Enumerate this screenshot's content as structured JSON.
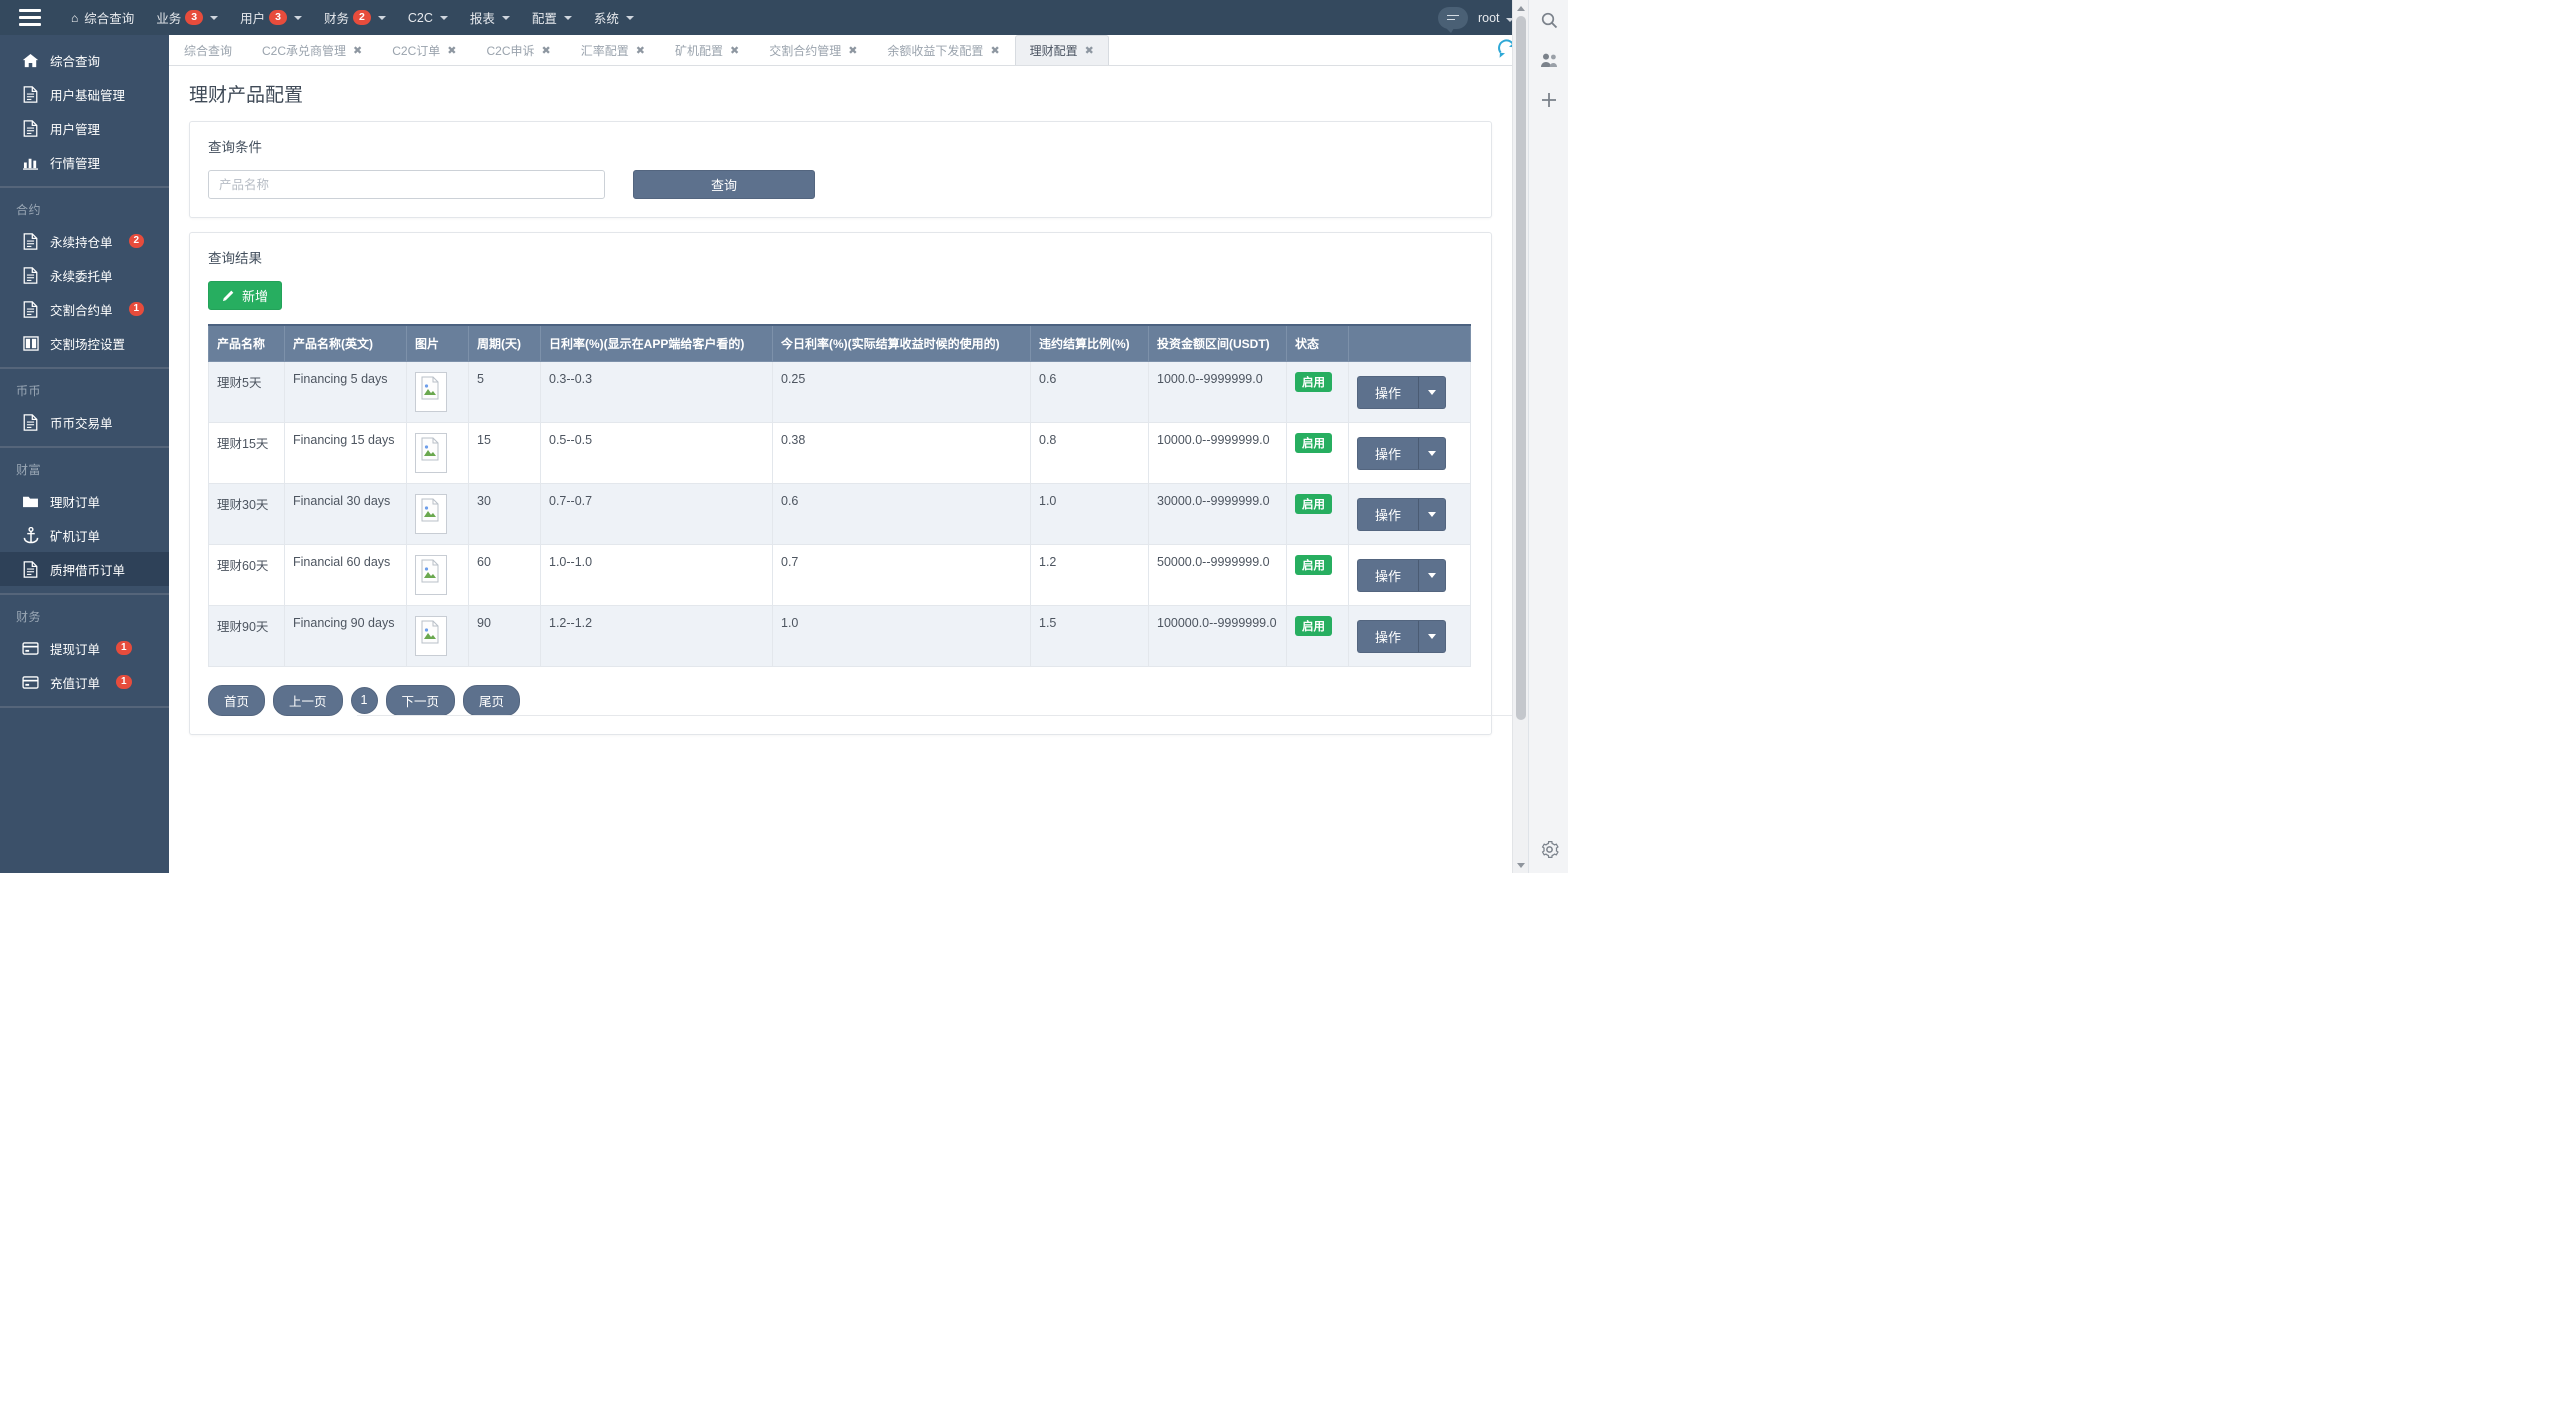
{
  "navbar": {
    "menu_icon": "hamburger-icon",
    "home_icon": "home-icon",
    "items": [
      {
        "label": "综合查询",
        "badge": null,
        "caret": false,
        "home": true
      },
      {
        "label": "业务",
        "badge": "3",
        "caret": true,
        "home": false
      },
      {
        "label": "用户",
        "badge": "3",
        "caret": true,
        "home": false
      },
      {
        "label": "财务",
        "badge": "2",
        "caret": true,
        "home": false
      },
      {
        "label": "C2C",
        "badge": null,
        "caret": true,
        "home": false
      },
      {
        "label": "报表",
        "badge": null,
        "caret": true,
        "home": false
      },
      {
        "label": "配置",
        "badge": null,
        "caret": true,
        "home": false
      },
      {
        "label": "系统",
        "badge": null,
        "caret": true,
        "home": false
      }
    ],
    "chat_icon": "chat-icon",
    "user": "root"
  },
  "sidebar": {
    "groups": [
      {
        "title": null,
        "items": [
          {
            "label": "综合查询",
            "icon": "home-icon",
            "badge": null,
            "active": false
          },
          {
            "label": "用户基础管理",
            "icon": "document-icon",
            "badge": null,
            "active": false
          },
          {
            "label": "用户管理",
            "icon": "document-icon",
            "badge": null,
            "active": false
          },
          {
            "label": "行情管理",
            "icon": "bar-chart-icon",
            "badge": null,
            "active": false
          }
        ]
      },
      {
        "title": "合约",
        "items": [
          {
            "label": "永续持仓单",
            "icon": "document-icon",
            "badge": "2",
            "active": false
          },
          {
            "label": "永续委托单",
            "icon": "document-icon",
            "badge": null,
            "active": false
          },
          {
            "label": "交割合约单",
            "icon": "document-icon",
            "badge": "1",
            "active": false
          },
          {
            "label": "交割场控设置",
            "icon": "columns-icon",
            "badge": null,
            "active": false
          }
        ]
      },
      {
        "title": "币币",
        "items": [
          {
            "label": "币币交易单",
            "icon": "document-icon",
            "badge": null,
            "active": false
          }
        ]
      },
      {
        "title": "财富",
        "items": [
          {
            "label": "理财订单",
            "icon": "folder-icon",
            "badge": null,
            "active": false
          },
          {
            "label": "矿机订单",
            "icon": "anchor-icon",
            "badge": null,
            "active": false
          },
          {
            "label": "质押借币订单",
            "icon": "document-icon",
            "badge": null,
            "active": true
          }
        ]
      },
      {
        "title": "财务",
        "items": [
          {
            "label": "提现订单",
            "icon": "credit-card-icon",
            "badge": "1",
            "active": false
          },
          {
            "label": "充值订单",
            "icon": "credit-card-icon",
            "badge": "1",
            "active": false
          }
        ]
      }
    ]
  },
  "tabs": {
    "items": [
      {
        "label": "综合查询",
        "closable": false,
        "active": false
      },
      {
        "label": "C2C承兑商管理",
        "closable": true,
        "active": false
      },
      {
        "label": "C2C订单",
        "closable": true,
        "active": false
      },
      {
        "label": "C2C申诉",
        "closable": true,
        "active": false
      },
      {
        "label": "汇率配置",
        "closable": true,
        "active": false
      },
      {
        "label": "矿机配置",
        "closable": true,
        "active": false
      },
      {
        "label": "交割合约管理",
        "closable": true,
        "active": false
      },
      {
        "label": "余额收益下发配置",
        "closable": true,
        "active": false
      },
      {
        "label": "理财配置",
        "closable": true,
        "active": true
      }
    ],
    "close_glyph": "✖",
    "refresh_icon": "refresh-icon"
  },
  "page": {
    "title": "理财产品配置"
  },
  "query_panel": {
    "heading": "查询条件",
    "product_name_placeholder": "产品名称",
    "product_name_value": "",
    "search_button": "查询"
  },
  "result_panel": {
    "heading": "查询结果",
    "add_button": "新增",
    "add_icon": "pencil-icon",
    "columns": [
      "产品名称",
      "产品名称(英文)",
      "图片",
      "周期(天)",
      "日利率(%)(显示在APP端给客户看的)",
      "今日利率(%)(实际结算收益时候的使用的)",
      "违约结算比例(%)",
      "投资金额区间(USDT)",
      "状态",
      ""
    ],
    "rows": [
      {
        "name": "理财5天",
        "name_en": "Financing 5 days",
        "image": "broken-image-icon",
        "period": "5",
        "daily_rate": "0.3--0.3",
        "today_rate": "0.25",
        "penalty_ratio": "0.6",
        "amount_range": "1000.0--9999999.0",
        "status": "启用",
        "action_label": "操作"
      },
      {
        "name": "理财15天",
        "name_en": "Financing 15 days",
        "image": "broken-image-icon",
        "period": "15",
        "daily_rate": "0.5--0.5",
        "today_rate": "0.38",
        "penalty_ratio": "0.8",
        "amount_range": "10000.0--9999999.0",
        "status": "启用",
        "action_label": "操作"
      },
      {
        "name": "理财30天",
        "name_en": "Financial 30 days",
        "image": "broken-image-icon",
        "period": "30",
        "daily_rate": "0.7--0.7",
        "today_rate": "0.6",
        "penalty_ratio": "1.0",
        "amount_range": "30000.0--9999999.0",
        "status": "启用",
        "action_label": "操作"
      },
      {
        "name": "理财60天",
        "name_en": "Financial 60 days",
        "image": "broken-image-icon",
        "period": "60",
        "daily_rate": "1.0--1.0",
        "today_rate": "0.7",
        "penalty_ratio": "1.2",
        "amount_range": "50000.0--9999999.0",
        "status": "启用",
        "action_label": "操作"
      },
      {
        "name": "理财90天",
        "name_en": "Financing 90 days",
        "image": "broken-image-icon",
        "period": "90",
        "daily_rate": "1.2--1.2",
        "today_rate": "1.0",
        "penalty_ratio": "1.5",
        "amount_range": "100000.0--9999999.0",
        "status": "启用",
        "action_label": "操作"
      }
    ],
    "pager": {
      "first": "首页",
      "prev": "上一页",
      "current": "1",
      "next": "下一页",
      "last": "尾页"
    }
  },
  "colors": {
    "navbar_bg": "#34495e",
    "sidebar_bg": "#3b5069",
    "sidebar_active": "#2e4158",
    "accent_button": "#5d718d",
    "success_green": "#27ae60",
    "badge_red": "#e74c3c",
    "table_header": "#697f9b",
    "refresh_blue": "#2fa8d6"
  }
}
